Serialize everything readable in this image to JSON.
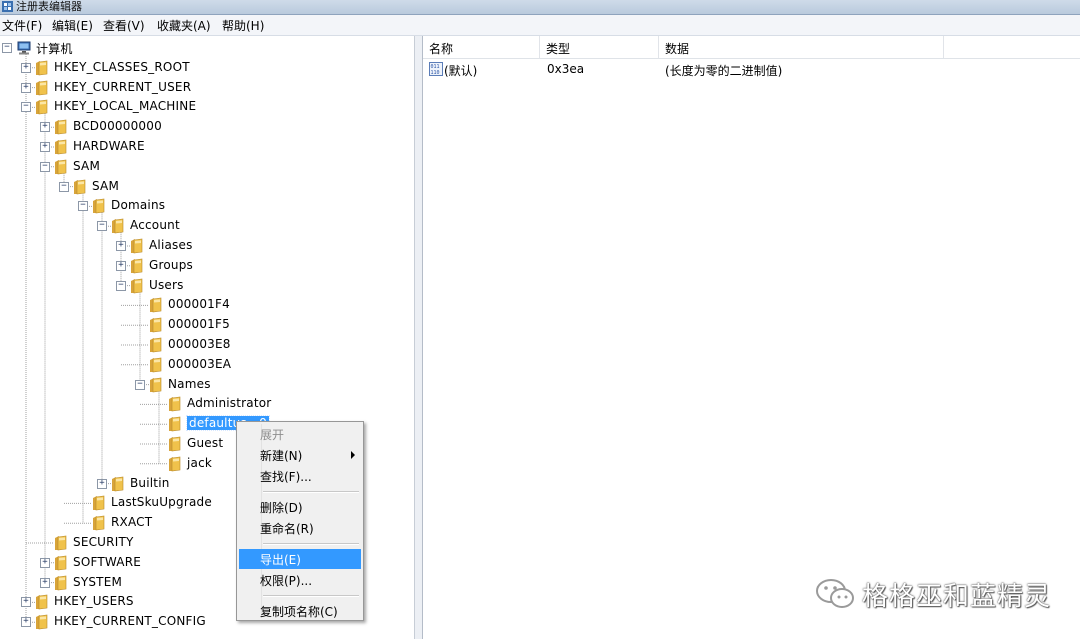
{
  "window": {
    "title": "注册表编辑器"
  },
  "menubar": [
    "文件(F)",
    "编辑(E)",
    "查看(V)",
    "收藏夹(A)",
    "帮助(H)"
  ],
  "tree": [
    {
      "label": "计算机",
      "level": 0,
      "exp": "minus",
      "icon": "computer"
    },
    {
      "label": "HKEY_CLASSES_ROOT",
      "level": 1,
      "exp": "plus"
    },
    {
      "label": "HKEY_CURRENT_USER",
      "level": 1,
      "exp": "plus"
    },
    {
      "label": "HKEY_LOCAL_MACHINE",
      "level": 1,
      "exp": "minus"
    },
    {
      "label": "BCD00000000",
      "level": 2,
      "exp": "plus"
    },
    {
      "label": "HARDWARE",
      "level": 2,
      "exp": "plus"
    },
    {
      "label": "SAM",
      "level": 2,
      "exp": "minus"
    },
    {
      "label": "SAM",
      "level": 3,
      "exp": "minus"
    },
    {
      "label": "Domains",
      "level": 4,
      "exp": "minus"
    },
    {
      "label": "Account",
      "level": 5,
      "exp": "minus"
    },
    {
      "label": "Aliases",
      "level": 6,
      "exp": "plus"
    },
    {
      "label": "Groups",
      "level": 6,
      "exp": "plus"
    },
    {
      "label": "Users",
      "level": 6,
      "exp": "minus"
    },
    {
      "label": "000001F4",
      "level": 7,
      "exp": "none"
    },
    {
      "label": "000001F5",
      "level": 7,
      "exp": "none"
    },
    {
      "label": "000003E8",
      "level": 7,
      "exp": "none"
    },
    {
      "label": "000003EA",
      "level": 7,
      "exp": "none"
    },
    {
      "label": "Names",
      "level": 7,
      "exp": "minus"
    },
    {
      "label": "Administrator",
      "level": 8,
      "exp": "none"
    },
    {
      "label": "defaultus…0",
      "level": 8,
      "exp": "none",
      "selected": true
    },
    {
      "label": "Guest",
      "level": 8,
      "exp": "none"
    },
    {
      "label": "jack",
      "level": 8,
      "exp": "none"
    },
    {
      "label": "Builtin",
      "level": 5,
      "exp": "plus"
    },
    {
      "label": "LastSkuUpgrade",
      "level": 4,
      "exp": "none"
    },
    {
      "label": "RXACT",
      "level": 4,
      "exp": "none"
    },
    {
      "label": "SECURITY",
      "level": 2,
      "exp": "none"
    },
    {
      "label": "SOFTWARE",
      "level": 2,
      "exp": "plus"
    },
    {
      "label": "SYSTEM",
      "level": 2,
      "exp": "plus"
    },
    {
      "label": "HKEY_USERS",
      "level": 1,
      "exp": "plus"
    },
    {
      "label": "HKEY_CURRENT_CONFIG",
      "level": 1,
      "exp": "plus"
    }
  ],
  "context_menu": [
    {
      "label": "展开",
      "state": "disabled"
    },
    {
      "label": "新建(N)",
      "state": "normal",
      "submenu": true
    },
    {
      "label": "查找(F)...",
      "state": "normal"
    },
    {
      "separator": true
    },
    {
      "label": "删除(D)",
      "state": "normal"
    },
    {
      "label": "重命名(R)",
      "state": "normal"
    },
    {
      "separator": true
    },
    {
      "label": "导出(E)",
      "state": "highlighted"
    },
    {
      "label": "权限(P)...",
      "state": "normal"
    },
    {
      "separator": true
    },
    {
      "label": "复制项名称(C)",
      "state": "normal"
    }
  ],
  "list": {
    "columns": [
      "名称",
      "类型",
      "数据"
    ],
    "rows": [
      {
        "name": "(默认)",
        "type": "0x3ea",
        "data": "(长度为零的二进制值)",
        "icon": "binary-value-icon"
      }
    ]
  },
  "watermark": {
    "text": "格格巫和蓝精灵"
  },
  "colors": {
    "selection": "#3399ff",
    "folder": "#f0c24b"
  }
}
